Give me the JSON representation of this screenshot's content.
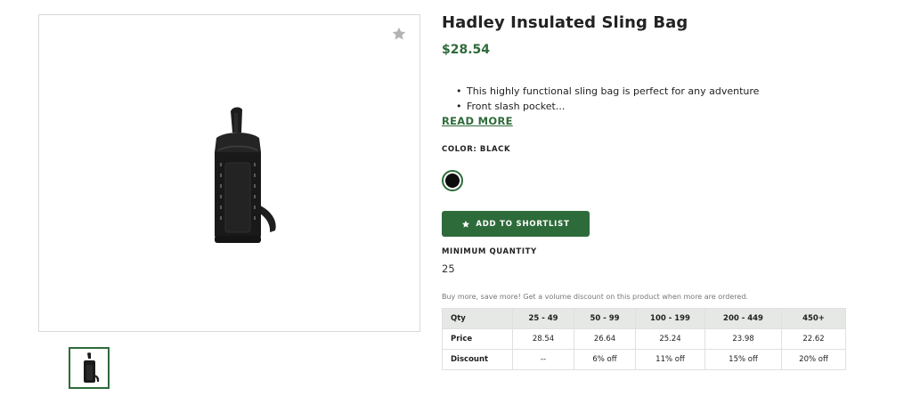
{
  "product": {
    "title": "Hadley Insulated Sling Bag",
    "price": "$28.54",
    "description": [
      "This highly functional sling bag is perfect for any adventure",
      "Front slash pocket..."
    ],
    "read_more_label": "READ MORE",
    "color_label": "COLOR: BLACK",
    "color_swatches": [
      {
        "name": "Black",
        "hex": "#0c0c0c",
        "selected": true
      }
    ],
    "shortlist_button_label": "ADD TO SHORTLIST",
    "min_quantity_label": "MINIMUM QUANTITY",
    "min_quantity_value": "25",
    "volume_note": "Buy more, save more! Get a volume discount on this product when more are ordered."
  },
  "pricing_table": {
    "header": [
      "Qty",
      "25 - 49",
      "50 - 99",
      "100 - 199",
      "200 - 449",
      "450+"
    ],
    "rows": [
      [
        "Price",
        "28.54",
        "26.64",
        "25.24",
        "23.98",
        "22.62"
      ],
      [
        "Discount",
        "--",
        "6% off",
        "11% off",
        "15% off",
        "20% off"
      ]
    ]
  },
  "icons": {
    "favorite": "star-icon",
    "shortlist": "star-icon"
  },
  "colors": {
    "accent": "#2e6b3a",
    "table_header_bg": "#e5e8e5",
    "muted_text": "#777777"
  }
}
